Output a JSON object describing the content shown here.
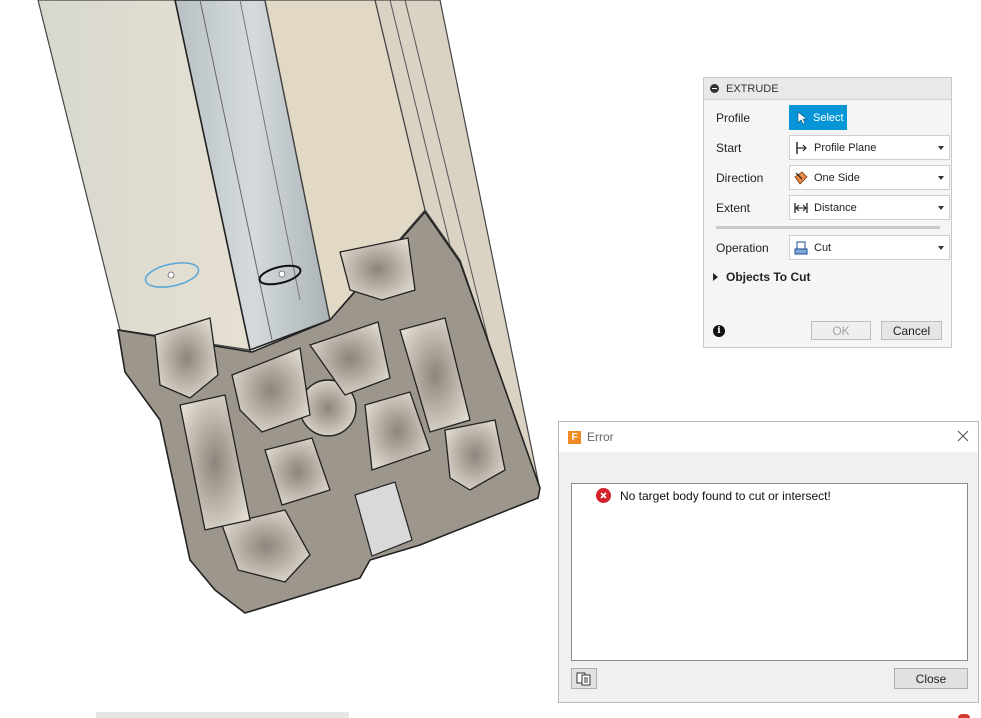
{
  "extrude": {
    "title": "EXTRUDE",
    "profile": {
      "label": "Profile",
      "button": "Select"
    },
    "start": {
      "label": "Start",
      "value": "Profile Plane",
      "icon": "profile-plane-icon"
    },
    "direction": {
      "label": "Direction",
      "value": "One Side",
      "icon": "one-side-icon"
    },
    "extent": {
      "label": "Extent",
      "value": "Distance",
      "icon": "distance-icon"
    },
    "operation": {
      "label": "Operation",
      "value": "Cut",
      "icon": "cut-icon"
    },
    "objects_to_cut": "Objects To Cut",
    "ok": "OK",
    "cancel": "Cancel"
  },
  "error_dialog": {
    "title": "Error",
    "message": "No target body found to cut or intersect!",
    "close": "Close"
  },
  "colors": {
    "accent": "#0696d7",
    "error": "#d4222a",
    "app_logo": "#f08a24"
  }
}
